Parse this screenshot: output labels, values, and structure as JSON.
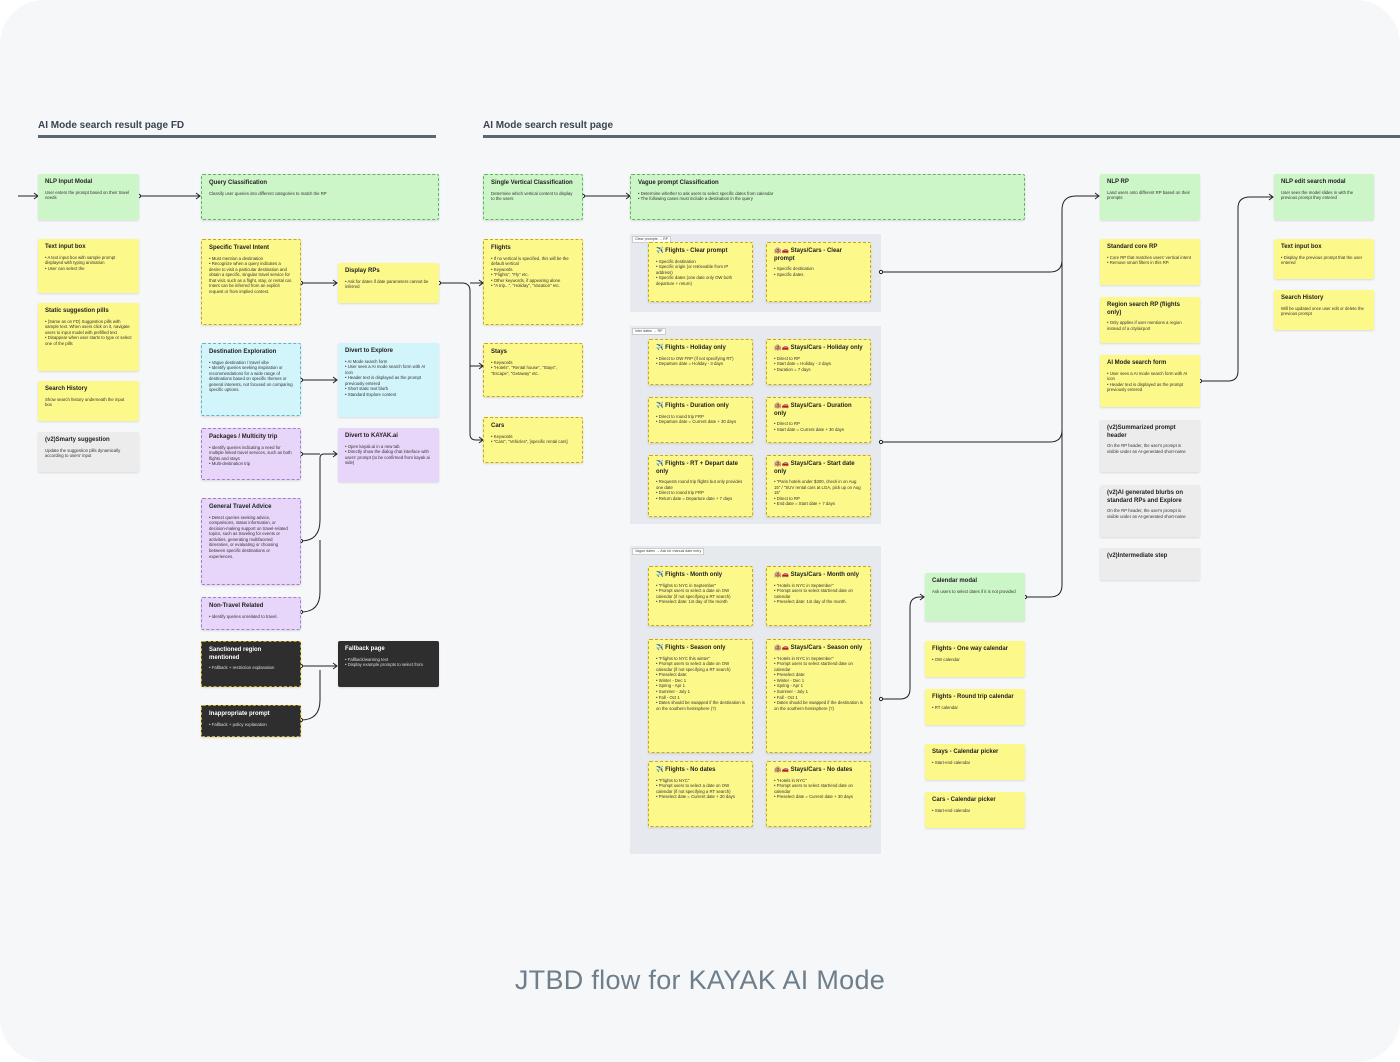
{
  "sections": {
    "left_title": "AI Mode search result page FD",
    "right_title": "AI Mode search result page"
  },
  "panels": {
    "clear_tag": "Clear prompts → RP",
    "infer_tag": "Infer dates → RP",
    "vague_tag": "Vague dates → Ask for manual date entry"
  },
  "notes": {
    "nlp_input_modal": {
      "title": "NLP Input Modal",
      "body": "User enters the prompt based on their travel needs"
    },
    "text_input_box_fd": {
      "title": "Text input box",
      "body": "• A text input box with sample prompt displayed with typing animation\n• User can select the"
    },
    "static_pills": {
      "title": "Static suggestion pills",
      "body": "• (Same as on FD) Suggestion pills with sample text. When users click on it, navigate users to input model with prefilled text\n• Disappear when user starts to type or select one of the pills"
    },
    "search_history_fd": {
      "title": "Search History",
      "body": "Show search history underneath the input box"
    },
    "smarty": {
      "title": "(v2)Smarty suggestion",
      "body": "Update the suggestion pills dynamically according to users' input"
    },
    "query_class": {
      "title": "Query Classification",
      "body": "Classify user queries into different categories to match the RP"
    },
    "specific_intent": {
      "title": "Specific Travel Intent",
      "body": "• Must mention a destination\n• Recognize when a query indicates a desire to visit a particular destination and obtain a specific, singular travel service for that visit, such as a flight, stay, or rental car. Intent can be inferred from an explicit request or from implied context."
    },
    "dest_explore": {
      "title": "Destination Exploration",
      "body": "• Vague destination / travel vibe\n• Identify queries seeking inspiration or recommendations for a wide range of destinations based on specific themes or general interests, not focused on comparing specific options."
    },
    "packages": {
      "title": "Packages / Multicity trip",
      "body": "• Identify queries indicating a need for multiple linked travel services, such as both flights and stays\n• Multi-destination trip"
    },
    "general_advice": {
      "title": "General Travel Advice",
      "body": "• Detect queries seeking advice, comparisons, status information, or decision-making support on travel-related topics, such as traveling for events or activities, generating multifaceted itineraries, or evaluating or choosing between specific destinations or experiences."
    },
    "non_travel": {
      "title": "Non-Travel Related",
      "body": "• Identify queries unrelated to travel."
    },
    "sanctioned": {
      "title": "Sanctioned region mentioned",
      "body": "• Fallback + restriction explanation"
    },
    "inappropriate": {
      "title": "Inappropriate prompt",
      "body": "• Fallback + policy explanation"
    },
    "display_rps": {
      "title": "Display RPs",
      "body": "• Ask for dates if date parameters cannot be inferred"
    },
    "divert_explore": {
      "title": "Divert to Explore",
      "body": "• AI Mode search form\n   • User sees a AI mode search form with AI icon\n   • Header text is displayed as the prompt previously entered\n• Short static text blurb\n• Standard Explore content"
    },
    "divert_kayak": {
      "title": "Divert to KAYAK.ai",
      "body": "• Open kayak.ai in a new tab\n• Directly show the dialog chat interface with users' prompt (to be confirmed from kayak ai side)"
    },
    "fallback": {
      "title": "Fallback page",
      "body": "• Fallback/warning text\n• Display example prompts to select from"
    },
    "single_vertical": {
      "title": "Single Vertical Classification",
      "body": "Determine which vertical content to display to the users"
    },
    "flights": {
      "title": "Flights",
      "body": "• If no vertical is specified, this will be the default vertical\n• Keywords\n   • \"Flights\", \"Fly\" etc.\n• Other keywords, if appearing alone\n   • \"A trip...\", \"Holiday\", \"Vacation\" etc."
    },
    "stays": {
      "title": "Stays",
      "body": "• Keywords\n   • \"Hotels\", \"Rental house\", \"Stays\", \"Escape\", \"Getaway\" etc."
    },
    "cars": {
      "title": "Cars",
      "body": "• Keywords\n   • \"Cars\", \"Vehicles\", [specific rental cars]"
    },
    "vague_class": {
      "title": "Vague prompt Classification",
      "body": "• Determine whether to ask users to select specific dates from calendar\n• The following cases must include a destination in the query"
    },
    "fl_clear": {
      "title": "✈️ Flights - Clear prompt",
      "body": "• Specific destination\n• Specific origin (or retrievable from IP address)\n• Specific dates (one date only OW both departure + return)"
    },
    "st_clear": {
      "title": "🏨🚗 Stays/Cars - Clear prompt",
      "body": "• Specific destination\n• Specific dates"
    },
    "fl_holiday": {
      "title": "✈️ Flights - Holiday only",
      "body": "• Direct to OW FRP (if not specifying RT)\n• Departure date = Holiday - 3 days"
    },
    "st_holiday": {
      "title": "🏨🚗 Stays/Cars - Holiday only",
      "body": "• Direct to RP\n• Start date = Holiday - 2 days\n• Duration = 7 days"
    },
    "fl_duration": {
      "title": "✈️ Flights - Duration only",
      "body": "• Direct to round trip FRP\n• Departure date = Current date + 30 days"
    },
    "st_duration": {
      "title": "🏨🚗 Stays/Cars - Duration only",
      "body": "• Direct to RP\n• Start date = Current date + 30 days"
    },
    "fl_rt_depart": {
      "title": "✈️ Flights - RT + Depart date only",
      "body": "• Requests round trip flights but only provides one date\n• Direct to round trip FRP\n• Return date = Departure date + 7 days"
    },
    "st_start": {
      "title": "🏨🚗 Stays/Cars - Start date only",
      "body": "• \"Paris hotels under $300, check in on Aug 15\" / \"SUV rental cars at LGA, pick up on Aug 15\"\n• Direct to RP\n• End date = Start date + 7 days"
    },
    "fl_month": {
      "title": "✈️ Flights - Month only",
      "body": "• \"Flights to NYC in September\"\n• Prompt users to select a date on OW calendar (if not specifying a RT search)\n• Preselect date: 1st day of the month"
    },
    "st_month": {
      "title": "🏨🚗 Stays/Cars - Month only",
      "body": "• \"Hotels in NYC in September\"\n• Prompt users to select start/end date on calendar\n• Preselect date: 1st day of the month."
    },
    "fl_season": {
      "title": "✈️ Flights - Season only",
      "body": "• \"Flights to NYC this winter\"\n• Prompt users to select a date on OW calendar (if not specifying a RT search)\n• Preselect date:\n   • Winter - Dec 1\n   • Spring - Apr 1\n   • Summer - July 1\n   • Fall - Oct 1\n• Dates should be swapped if the destination is on the southern hemisphere (?)"
    },
    "st_season": {
      "title": "🏨🚗 Stays/Cars - Season only",
      "body": "• \"Hotels in NYC in September\"\n• Prompt users to select start/end date on calendar\n• Preselect date:\n   • Winter - Dec 1\n   • Spring - Apr 1\n   • Summer - July 1\n   • Fall - Oct 1\n• Dates should be swapped if the destination is on the southern hemisphere (?)"
    },
    "fl_nodates": {
      "title": "✈️ Flights - No dates",
      "body": "• \"Flights to NYC\"\n• Prompt users to select a date on OW calendar (if not specifying a RT search)\n• Preselect date = Current date + 30 days"
    },
    "st_nodates": {
      "title": "🏨🚗 Stays/Cars - No dates",
      "body": "• \"Hotels in NYC\"\n• Prompt users to select start/end date on calendar\n• Preselect date = Current date + 30 days"
    },
    "calendar_modal": {
      "title": "Calendar modal",
      "body": "Ask users to select dates if it is not provided"
    },
    "fl_ow_cal": {
      "title": "Flights - One way calendar",
      "body": "• OW calendar"
    },
    "fl_rt_cal": {
      "title": "Flights - Round trip calendar",
      "body": "• RT calendar"
    },
    "st_cal": {
      "title": "Stays - Calendar picker",
      "body": "• Start-end calendar"
    },
    "car_cal": {
      "title": "Cars - Calendar picker",
      "body": "• Start-end calendar"
    },
    "nlp_rp": {
      "title": "NLP RP",
      "body": "Land users onto different RP based on their prompts"
    },
    "standard_core": {
      "title": "Standard core RP",
      "body": "• Core RP that matches users' vertical intent\n• Remove smart filters in this RP."
    },
    "region_rp": {
      "title": "Region search RP (flights only)",
      "body": "• Only applies if user mentions a region instead of a city/airport"
    },
    "ai_form": {
      "title": "AI Mode search form",
      "body": "• User sees a AI mode search form with AI icon\n• Header text is displayed as the prompt previously entered"
    },
    "summ_header": {
      "title": "(v2)Summarized prompt header",
      "body": "On the RP header, the user's prompt is visible under an AI-generated short-name"
    },
    "ai_blurbs": {
      "title": "(v2)AI generated blurbs on standard RPs and Explore",
      "body": "On the RP header, the user's prompt is visible under an AI-generated short-name"
    },
    "intermediate": {
      "title": "(v2)Intermediate step",
      "body": ""
    },
    "nlp_edit": {
      "title": "NLP edit search modal",
      "body": "User sees the model slides in with the previous prompt they entered"
    },
    "text_input_rp": {
      "title": "Text input box",
      "body": "• Display the previous prompt that the user entered"
    },
    "search_history_rp": {
      "title": "Search History",
      "body": "Will be updated once user edit or delete the previous prompt"
    }
  },
  "footer": "JTBD flow for KAYAK AI Mode",
  "colors": {
    "sticky_yellow": "#fdf88a",
    "sticky_green": "#cdf6c8",
    "sticky_cyan": "#d2f4fb",
    "sticky_purple": "#e8d5fa",
    "sticky_dark": "#2e2e2e",
    "sticky_grey": "#ececec",
    "connector": "#222222",
    "panel": "#e6e9ee"
  }
}
